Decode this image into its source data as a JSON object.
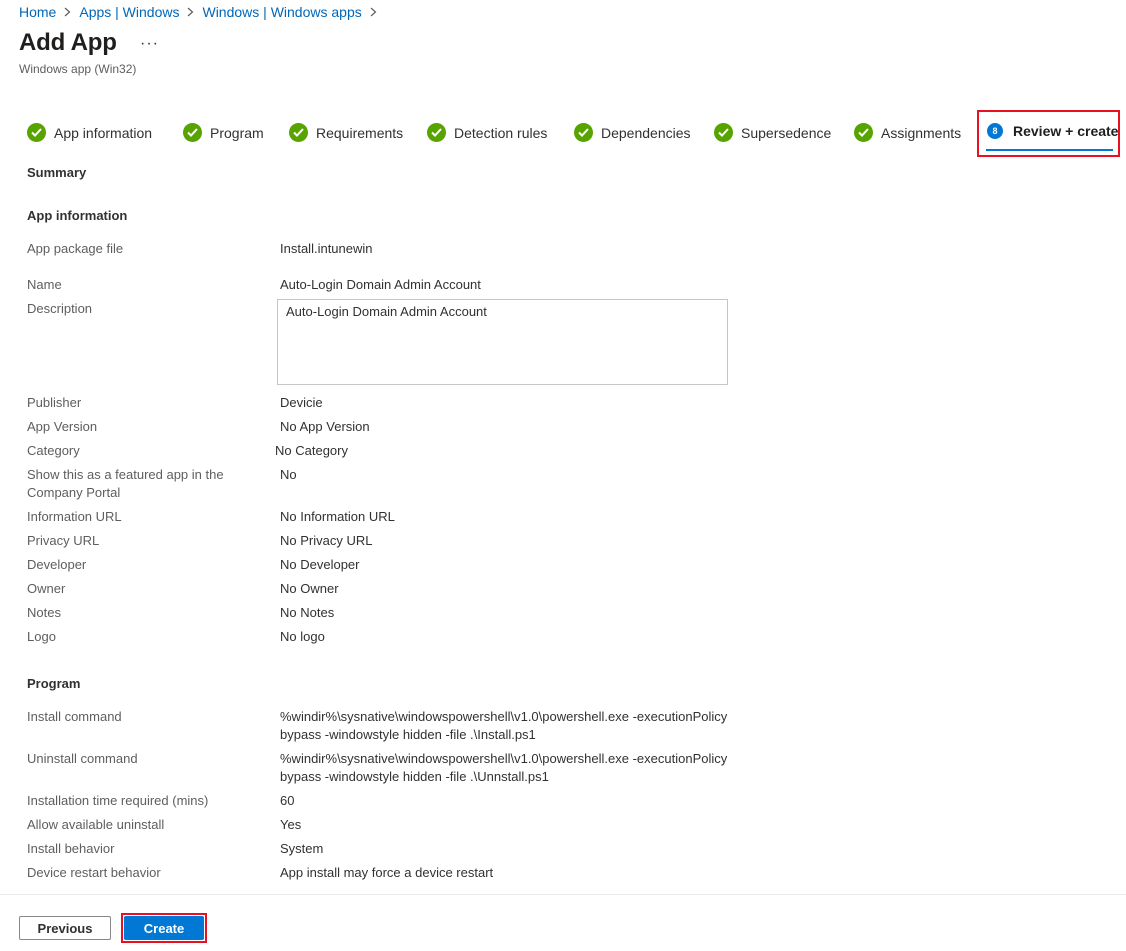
{
  "breadcrumb": [
    "Home",
    "Apps | Windows",
    "Windows | Windows apps"
  ],
  "header": {
    "title": "Add App",
    "more": "···",
    "subtitle": "Windows app (Win32)"
  },
  "steps": [
    {
      "label": "App information",
      "status": "complete"
    },
    {
      "label": "Program",
      "status": "complete"
    },
    {
      "label": "Requirements",
      "status": "complete"
    },
    {
      "label": "Detection rules",
      "status": "complete"
    },
    {
      "label": "Dependencies",
      "status": "complete"
    },
    {
      "label": "Supersedence",
      "status": "complete"
    },
    {
      "label": "Assignments",
      "status": "complete"
    },
    {
      "label": "Review + create",
      "status": "active",
      "number": "8"
    }
  ],
  "summary_title": "Summary",
  "app_info": {
    "title": "App information",
    "package_label": "App package file",
    "package_value": "Install.intunewin",
    "name_label": "Name",
    "name_value": "Auto-Login Domain Admin Account",
    "description_label": "Description",
    "description_value": "Auto-Login Domain Admin Account",
    "publisher_label": "Publisher",
    "publisher_value": "Devicie",
    "version_label": "App Version",
    "version_value": "No App Version",
    "category_label": "Category",
    "category_value": "No Category",
    "featured_label": "Show this as a featured app in the Company Portal",
    "featured_value": "No",
    "info_url_label": "Information URL",
    "info_url_value": "No Information URL",
    "privacy_label": "Privacy URL",
    "privacy_value": "No Privacy URL",
    "developer_label": "Developer",
    "developer_value": "No Developer",
    "owner_label": "Owner",
    "owner_value": "No Owner",
    "notes_label": "Notes",
    "notes_value": "No Notes",
    "logo_label": "Logo",
    "logo_value": "No logo"
  },
  "program": {
    "title": "Program",
    "install_label": "Install command",
    "install_line1": "%windir%\\sysnative\\windowspowershell\\v1.0\\powershell.exe -executionPolicy",
    "install_line2": "bypass -windowstyle hidden -file .\\Install.ps1",
    "uninstall_label": "Uninstall command",
    "uninstall_line1": "%windir%\\sysnative\\windowspowershell\\v1.0\\powershell.exe -executionPolicy",
    "uninstall_line2": "bypass -windowstyle hidden -file .\\Unnstall.ps1",
    "time_label": "Installation time required (mins)",
    "time_value": "60",
    "allow_uninstall_label": "Allow available uninstall",
    "allow_uninstall_value": "Yes",
    "behavior_label": "Install behavior",
    "behavior_value": "System",
    "restart_label": "Device restart behavior",
    "restart_value": "App install may force a device restart"
  },
  "footer": {
    "previous": "Previous",
    "create": "Create"
  },
  "colors": {
    "accent": "#0078d4",
    "success": "#57a300",
    "highlight": "#e81123"
  }
}
